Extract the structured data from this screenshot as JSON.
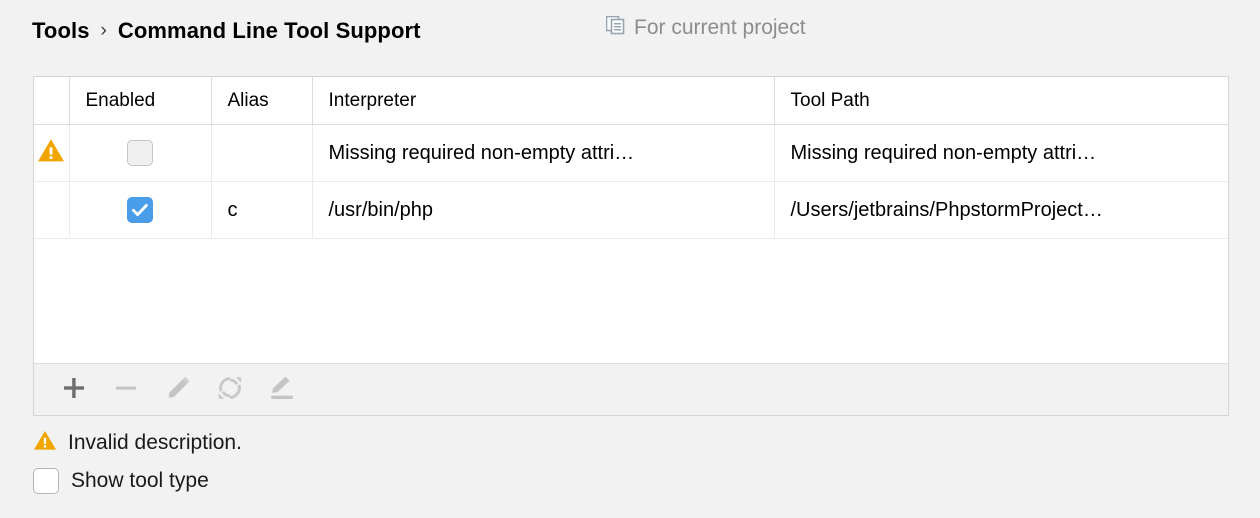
{
  "header": {
    "breadcrumb": [
      "Tools",
      "Command Line Tool Support"
    ],
    "separator": "›",
    "scope_icon": "modules-copy-icon",
    "scope_label": "For current project"
  },
  "table": {
    "columns": [
      "",
      "Enabled",
      "Alias",
      "Interpreter",
      "Tool Path"
    ],
    "rows": [
      {
        "status_icon": "warning-triangle-icon",
        "enabled": false,
        "enabled_state": "unchecked-disabled",
        "alias": "",
        "interpreter": "Missing required non-empty attri…",
        "interpreter_muted": true,
        "tool_path": "Missing required non-empty attri…",
        "tool_path_muted": true
      },
      {
        "status_icon": "",
        "enabled": true,
        "enabled_state": "checked",
        "alias": "c",
        "interpreter": "/usr/bin/php",
        "interpreter_muted": false,
        "tool_path": "/Users/jetbrains/PhpstormProject…",
        "tool_path_muted": false
      }
    ]
  },
  "toolbar": {
    "buttons": [
      {
        "name": "add-button",
        "icon": "plus-icon",
        "enabled": true
      },
      {
        "name": "remove-button",
        "icon": "minus-icon",
        "enabled": false
      },
      {
        "name": "edit-button",
        "icon": "pencil-icon",
        "enabled": false
      },
      {
        "name": "refresh-button",
        "icon": "refresh-icon",
        "enabled": false
      },
      {
        "name": "edit-path-button",
        "icon": "pencil-underline-icon",
        "enabled": false
      }
    ]
  },
  "footer": {
    "invalid_icon": "warning-triangle-icon",
    "invalid_message": "Invalid description.",
    "show_tool_type_label": "Show tool type",
    "show_tool_type_checked": false
  },
  "colors": {
    "warning": "#f0a500",
    "checkbox_accent": "#4a9de8",
    "panel_background": "#ffffff",
    "window_background": "#f2f2f2",
    "muted_text": "#9a9a9a",
    "border": "#dcdcdc"
  }
}
